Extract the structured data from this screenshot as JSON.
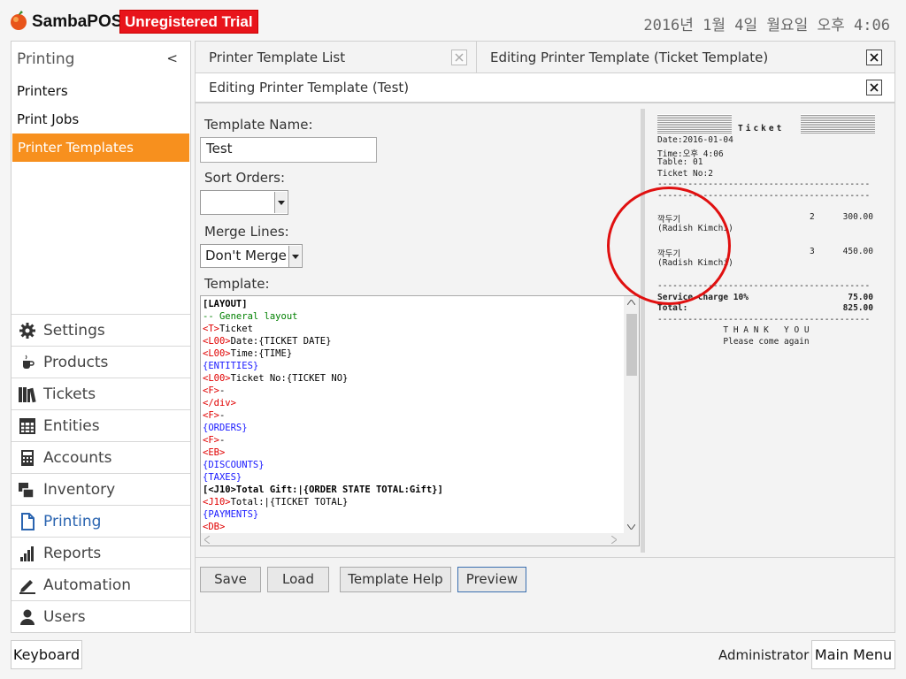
{
  "header": {
    "brand": "SambaPOS",
    "trial_badge": "Unregistered Trial",
    "datetime": "2016년 1월 4일 월요일 오후 4:06"
  },
  "sidebar": {
    "section_title": "Printing",
    "collapse_glyph": "<",
    "sub_items": [
      {
        "label": "Printers",
        "active": false
      },
      {
        "label": "Print Jobs",
        "active": false
      },
      {
        "label": "Printer Templates",
        "active": true
      }
    ],
    "nav_items": [
      {
        "label": "Settings",
        "icon": "gear-icon"
      },
      {
        "label": "Products",
        "icon": "coffee-cup-icon"
      },
      {
        "label": "Tickets",
        "icon": "books-icon"
      },
      {
        "label": "Entities",
        "icon": "grid-icon"
      },
      {
        "label": "Accounts",
        "icon": "calculator-icon"
      },
      {
        "label": "Inventory",
        "icon": "boxes-icon"
      },
      {
        "label": "Printing",
        "icon": "document-icon",
        "active": true
      },
      {
        "label": "Reports",
        "icon": "bar-chart-icon"
      },
      {
        "label": "Automation",
        "icon": "pen-icon"
      },
      {
        "label": "Users",
        "icon": "user-icon"
      }
    ]
  },
  "tabs": [
    {
      "label": "Printer Template List"
    },
    {
      "label": "Editing Printer Template (Ticket Template)"
    }
  ],
  "document": {
    "title": "Editing Printer Template (Test)"
  },
  "form": {
    "template_name_label": "Template Name:",
    "template_name_value": "Test",
    "sort_orders_label": "Sort Orders:",
    "sort_orders_value": "",
    "merge_lines_label": "Merge Lines:",
    "merge_lines_value": "Don't Merge",
    "template_label": "Template:"
  },
  "template_lines": [
    {
      "text": "[LAYOUT]",
      "color": "#000000",
      "bold": true
    },
    {
      "text": "-- General layout",
      "color": "#008000"
    },
    {
      "tag": "<T>",
      "text": "Ticket",
      "tag_color": "#e00000",
      "color": "#000000"
    },
    {
      "tag": "<L00>",
      "text": "Date:{TICKET DATE}",
      "tag_color": "#e00000",
      "color": "#000000"
    },
    {
      "tag": "<L00>",
      "text": "Time:{TIME}",
      "tag_color": "#e00000",
      "color": "#000000"
    },
    {
      "text": "{ENTITIES}",
      "color": "#1a1aff"
    },
    {
      "tag": "<L00>",
      "text": "Ticket No:{TICKET NO}",
      "tag_color": "#e00000",
      "color": "#000000"
    },
    {
      "tag": "<F>",
      "text": "-",
      "tag_color": "#e00000",
      "color": "#000000"
    },
    {
      "text": "</div>",
      "color": "#e00000"
    },
    {
      "tag": "<F>",
      "text": "-",
      "tag_color": "#e00000",
      "color": "#000000"
    },
    {
      "text": "{ORDERS}",
      "color": "#1a1aff"
    },
    {
      "tag": "<F>",
      "text": "-",
      "tag_color": "#e00000",
      "color": "#000000"
    },
    {
      "text": "<EB>",
      "color": "#e00000"
    },
    {
      "text": "{DISCOUNTS}",
      "color": "#1a1aff"
    },
    {
      "text": "{TAXES}",
      "color": "#1a1aff"
    },
    {
      "text": "[<J10>Total Gift:|{ORDER STATE TOTAL:Gift}]",
      "color": "#000000",
      "bold": true
    },
    {
      "tag": "<J10>",
      "text": "Total:|{TICKET TOTAL}",
      "tag_color": "#e00000",
      "color": "#000000"
    },
    {
      "text": "{PAYMENTS}",
      "color": "#1a1aff"
    },
    {
      "text": "<DB>",
      "color": "#e00000"
    }
  ],
  "preview": {
    "title": "Ticket",
    "header_lines": [
      "Date:2016-01-04",
      "Time:오후 4:06",
      "Table: 01",
      "Ticket No:2"
    ],
    "items": [
      {
        "name": "깍두기",
        "note": "(Radish Kimchi)",
        "qty": "2",
        "price": "300.00"
      },
      {
        "name": "깍두기",
        "note": "(Radish Kimchi)",
        "qty": "3",
        "price": "450.00"
      }
    ],
    "service_charge_label": "Service Charge 10%",
    "service_charge_value": "75.00",
    "total_label": "Total:",
    "total_value": "825.00",
    "thank_you": "T H A N K   Y O U",
    "come_again": "Please come again",
    "annotation_color": "#e01010"
  },
  "buttons": {
    "save": "Save",
    "load": "Load",
    "help": "Template Help",
    "preview": "Preview"
  },
  "footer": {
    "keyboard": "Keyboard",
    "user": "Administrator",
    "main_menu": "Main Menu"
  }
}
